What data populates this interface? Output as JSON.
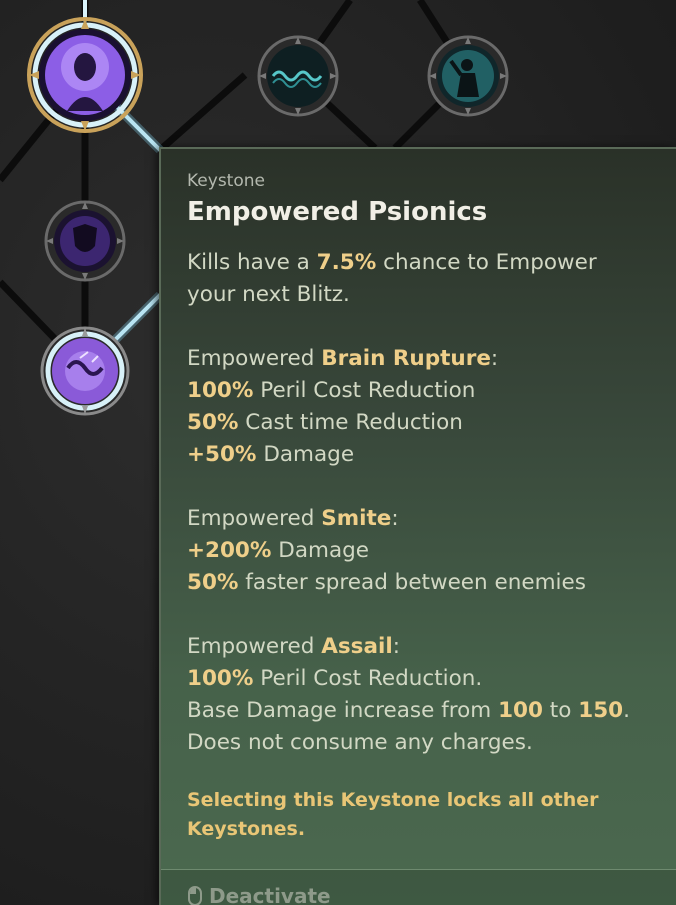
{
  "tree": {
    "nodes": [
      {
        "id": "selected-keystone",
        "icon": "psionic-head-icon",
        "state": "selected",
        "color": "#7a4bd6"
      },
      {
        "id": "blitz-wave",
        "icon": "wave-pattern-icon",
        "state": "available",
        "color": "#2d8a8f"
      },
      {
        "id": "blitz-figure",
        "icon": "figure-cast-icon",
        "state": "available",
        "color": "#2d8a8f"
      },
      {
        "id": "shield-talent",
        "icon": "shield-icon",
        "state": "locked",
        "color": "#4a2f7a"
      },
      {
        "id": "brain-rupture",
        "icon": "brain-rupture-icon",
        "state": "selected",
        "color": "#8a5ad8"
      }
    ]
  },
  "tooltip": {
    "category": "Keystone",
    "title": "Empowered Psionics",
    "intro": {
      "p1": "Kills have a ",
      "chance": "7.5%",
      "p2": " chance to Empower",
      "line2": "your next Blitz."
    },
    "sections": [
      {
        "prefix": "Empowered ",
        "name": "Brain Rupture",
        "colon": ":",
        "lines": [
          {
            "value": "100%",
            "text": " Peril Cost Reduction"
          },
          {
            "value": "50%",
            "text": " Cast time Reduction"
          },
          {
            "value": "+50%",
            "text": " Damage"
          }
        ]
      },
      {
        "prefix": "Empowered ",
        "name": "Smite",
        "colon": ":",
        "lines": [
          {
            "value": "+200%",
            "text": " Damage"
          },
          {
            "value": "50%",
            "text": " faster spread between enemies"
          }
        ]
      },
      {
        "prefix": "Empowered ",
        "name": "Assail",
        "colon": ":",
        "lines": [
          {
            "value": "100%",
            "text": " Peril Cost Reduction."
          }
        ],
        "damage": {
          "pre": "Base Damage increase from ",
          "from": "100",
          "mid": " to ",
          "to": "150",
          "post": "."
        },
        "last": "Does not consume any charges."
      }
    ],
    "warning": {
      "line1": "Selecting this Keystone locks all other",
      "line2": "Keystones."
    },
    "footer": {
      "action": "Deactivate",
      "icon": "mouse-icon"
    }
  },
  "colors": {
    "highlight": "#efcf8a",
    "warning": "#e9c676",
    "body": "#d2d8c4",
    "glow_line": "#bfe8f4"
  }
}
